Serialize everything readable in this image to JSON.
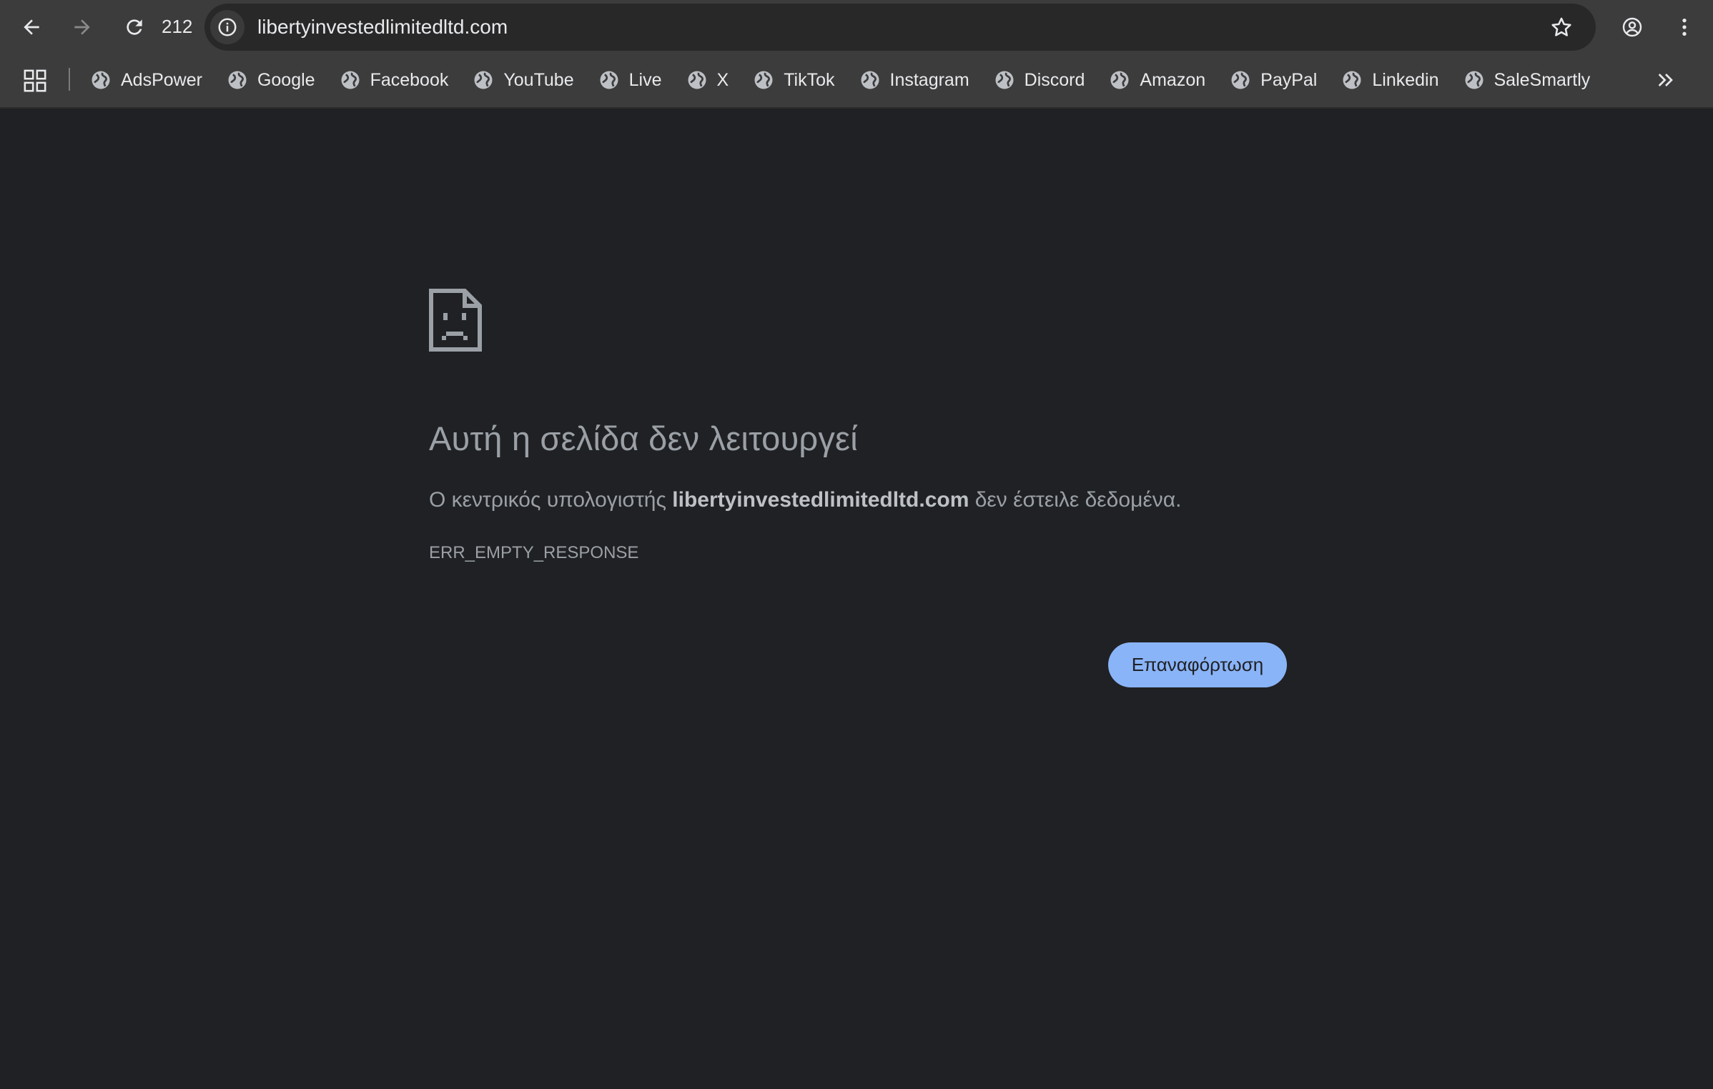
{
  "toolbar": {
    "reload_count": "212",
    "url": "libertyinvestedlimitedltd.com"
  },
  "bookmarks": [
    {
      "label": "AdsPower"
    },
    {
      "label": "Google"
    },
    {
      "label": "Facebook"
    },
    {
      "label": "YouTube"
    },
    {
      "label": "Live"
    },
    {
      "label": "X"
    },
    {
      "label": "TikTok"
    },
    {
      "label": "Instagram"
    },
    {
      "label": "Discord"
    },
    {
      "label": "Amazon"
    },
    {
      "label": "PayPal"
    },
    {
      "label": "Linkedin"
    },
    {
      "label": "SaleSmartly"
    }
  ],
  "error": {
    "title": "Αυτή η σελίδα δεν λειτουργεί",
    "desc_prefix": "Ο κεντρικός υπολογιστής ",
    "host": "libertyinvestedlimitedltd.com",
    "desc_suffix": " δεν έστειλε δεδομένα.",
    "code": "ERR_EMPTY_RESPONSE",
    "reload_label": "Επαναφόρτωση"
  },
  "colors": {
    "background": "#202124",
    "toolbar": "#3c3c3c",
    "button": "#8ab4f8"
  }
}
